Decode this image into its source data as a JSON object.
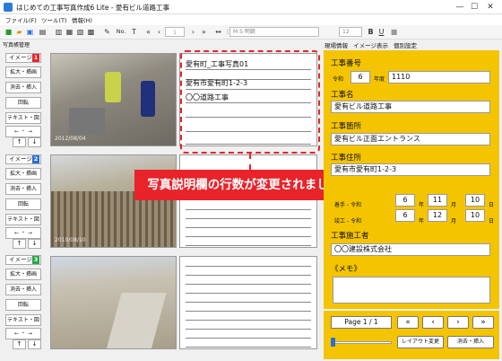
{
  "window": {
    "title": "はじめての工事写真作成6 Lite - 愛有ビル道路工事",
    "min": "—",
    "max": "☐",
    "close": "✕"
  },
  "menu": [
    "ファイル(F)",
    "ツール(T)",
    "情報(H)"
  ],
  "toolbar": {
    "font_name": "M S 明朝",
    "font_size": "12",
    "no_label": "No."
  },
  "left_tab": "写真帳管理",
  "sidebar": [
    {
      "label": "イメージ",
      "num": "1",
      "color": "#e8232a"
    },
    {
      "label": "イメージ",
      "num": "2",
      "color": "#2a6fd0"
    },
    {
      "label": "イメージ",
      "num": "3",
      "color": "#2aa54a"
    }
  ],
  "sidebar_buttons": {
    "zoom": "拡大・挿画",
    "delete": "消去・挿入",
    "rotate": "回転",
    "text": "テキスト・図",
    "arrows": "← ・ →"
  },
  "photos": [
    {
      "date": "2012/08/04"
    },
    {
      "date": "2010/08/10"
    },
    {
      "date": ""
    }
  ],
  "memo": {
    "line1": "愛有町_工事写真01",
    "line2": "愛有市愛有町1-2-3",
    "line3": "〇〇道路工事"
  },
  "callout": "写真説明欄の行数が変更されました。",
  "right_tabs": [
    "現場情報",
    "イメージ表示",
    "個別設定"
  ],
  "info": {
    "no_label": "工事番号",
    "era": "令和",
    "era_year": "6",
    "year_unit": "年度",
    "number": "1110",
    "name_label": "工事名",
    "name": "愛有ビル道路工事",
    "place_label": "工事箇所",
    "place": "愛有ビル正面エントランス",
    "addr_label": "工事住所",
    "addr": "愛有市愛有町1-2-3",
    "start_label": "着手",
    "end_label": "竣工",
    "era2": "- 令和",
    "start": {
      "y": "6",
      "m": "11",
      "d": "10"
    },
    "end": {
      "y": "6",
      "m": "12",
      "d": "10"
    },
    "y": "年",
    "m": "月",
    "d": "日",
    "contractor_label": "工事施工者",
    "contractor": "〇〇建設株式会社",
    "memo_label": "《メモ》"
  },
  "nav": {
    "page": "Page 1 / 1",
    "layout": "レイアウト変更",
    "delete": "消去・挿入"
  }
}
